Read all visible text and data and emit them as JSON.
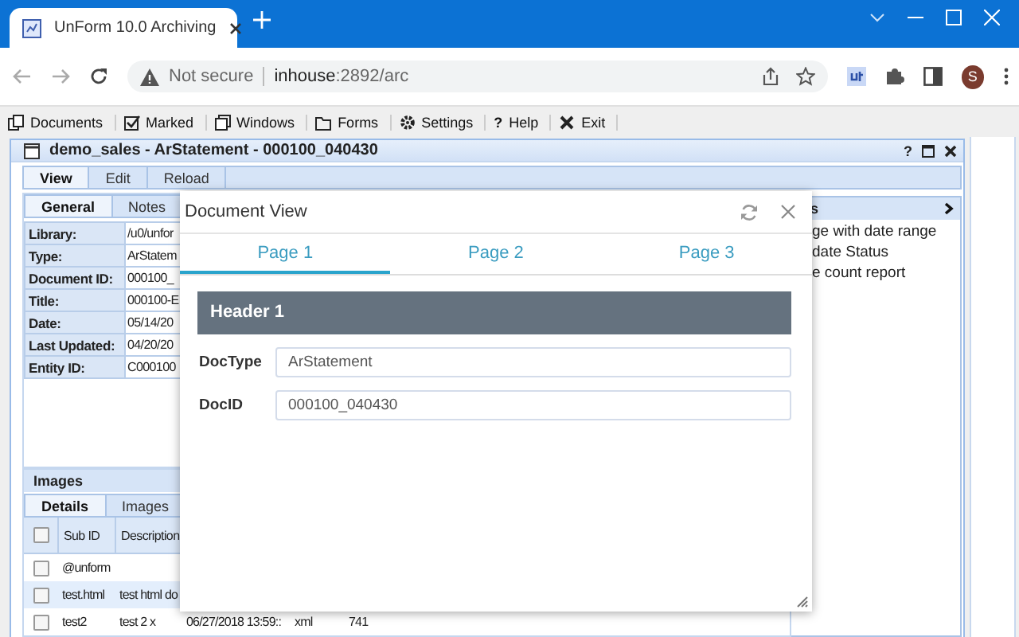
{
  "browser": {
    "tab": {
      "title": "UnForm 10.0 Archiving"
    },
    "address": {
      "security": "Not secure",
      "host": "inhouse",
      "path": ":2892/arc"
    },
    "profile": "S"
  },
  "menu": [
    {
      "label": "Documents"
    },
    {
      "label": "Marked"
    },
    {
      "label": "Windows"
    },
    {
      "label": "Forms"
    },
    {
      "label": "Settings"
    },
    {
      "label": "Help",
      "glyph": "?"
    },
    {
      "label": "Exit"
    }
  ],
  "window": {
    "title": "demo_sales - ArStatement - 000100_040430",
    "help_glyph": "?",
    "tabs": [
      {
        "label": "View",
        "selected": true
      },
      {
        "label": "Edit",
        "selected": false
      },
      {
        "label": "Reload",
        "selected": false
      }
    ],
    "subtabs": [
      {
        "label": "General",
        "selected": true
      },
      {
        "label": "Notes",
        "selected": false
      }
    ],
    "properties": [
      {
        "label": "Library:",
        "value": "/u0/unfor"
      },
      {
        "label": "Type:",
        "value": "ArStatem"
      },
      {
        "label": "Document ID:",
        "value": "000100_"
      },
      {
        "label": "Title:",
        "value": "000100-E"
      },
      {
        "label": "Date:",
        "value": "05/14/20"
      },
      {
        "label": "Last Updated:",
        "value": "04/20/20"
      },
      {
        "label": "Entity ID:",
        "value": "C000100"
      }
    ],
    "side_panel": {
      "title": "s",
      "items": [
        "ge with date range",
        "date Status",
        "e count report"
      ]
    },
    "images": {
      "title": "Images",
      "tabs": [
        {
          "label": "Details",
          "selected": true
        },
        {
          "label": "Images",
          "selected": false
        }
      ],
      "table": {
        "header_checked": false,
        "columns": [
          "Sub ID",
          "Description"
        ],
        "rows": [
          {
            "checked": false,
            "selected": false,
            "cells": [
              "@unform"
            ]
          },
          {
            "checked": false,
            "selected": true,
            "cells": [
              "test.html",
              "test html do"
            ]
          },
          {
            "checked": false,
            "selected": false,
            "cells": [
              "test2",
              "test 2 x",
              "06/27/2018 13:59::",
              "xml",
              "741"
            ]
          }
        ]
      }
    }
  },
  "dialog": {
    "title": "Document View",
    "tabs": [
      {
        "label": "Page 1",
        "selected": true
      },
      {
        "label": "Page 2",
        "selected": false
      },
      {
        "label": "Page 3",
        "selected": false
      }
    ],
    "section": "Header 1",
    "fields": [
      {
        "label": "DocType",
        "value": "ArStatement"
      },
      {
        "label": "DocID",
        "value": "000100_040430"
      }
    ]
  }
}
